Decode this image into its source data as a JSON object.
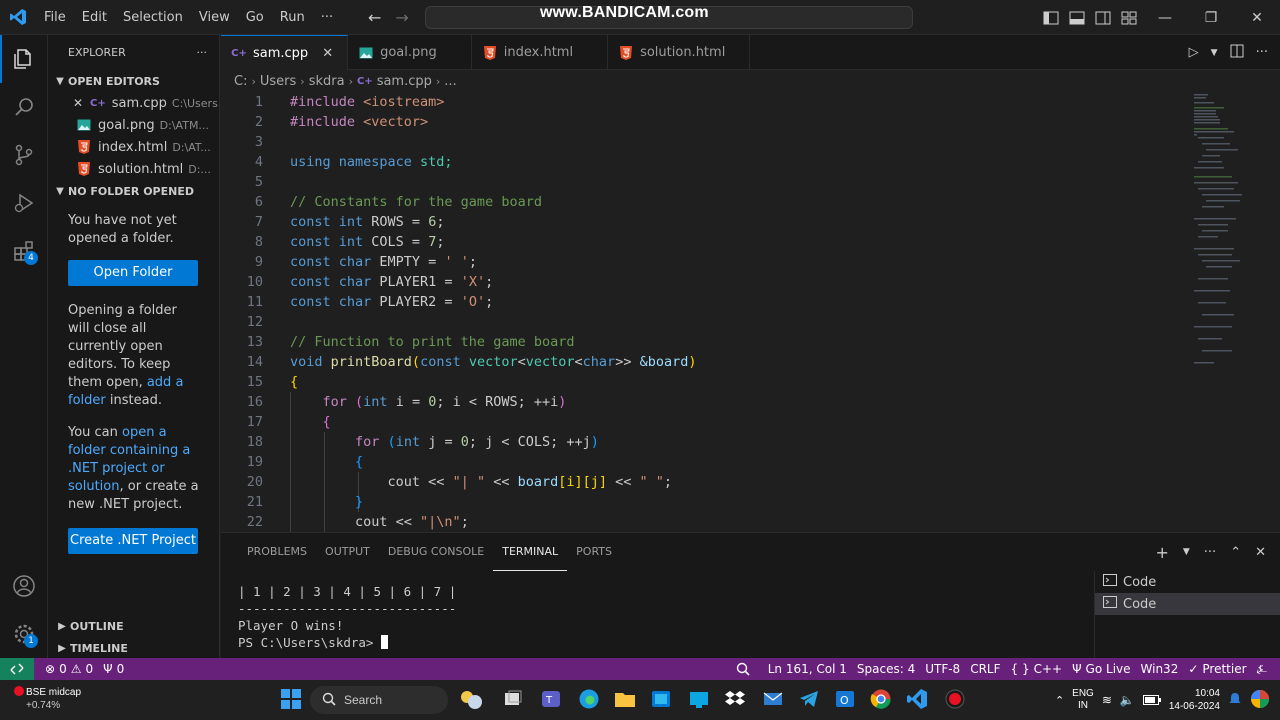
{
  "title_bar": {
    "menu": [
      "File",
      "Edit",
      "Selection",
      "View",
      "Go",
      "Run",
      "···"
    ],
    "watermark": "www.BANDICAM.com"
  },
  "sidebar": {
    "header": "EXPLORER",
    "open_editors_title": "OPEN EDITORS",
    "open_editors": [
      {
        "name": "sam.cpp",
        "path": "C:\\Users...",
        "icon": "cpp-file-icon"
      },
      {
        "name": "goal.png",
        "path": "D:\\ATM...",
        "icon": "image-file-icon"
      },
      {
        "name": "index.html",
        "path": "D:\\AT...",
        "icon": "html-file-icon"
      },
      {
        "name": "solution.html",
        "path": "D:...",
        "icon": "html-file-icon"
      }
    ],
    "no_folder_title": "NO FOLDER OPENED",
    "no_folder_text": "You have not yet opened a folder.",
    "open_folder_button": "Open Folder",
    "opening_text_1": "Opening a folder will close all currently open editors. To keep them open, ",
    "opening_link": "add a folder",
    "opening_text_2": " instead.",
    "net_text_1": "You can ",
    "net_link": "open a folder containing a .NET project or solution",
    "net_text_2": ", or create a new .NET project.",
    "create_net_button": "Create .NET Project",
    "outline_title": "OUTLINE",
    "timeline_title": "TIMELINE"
  },
  "tabs": [
    {
      "label": "sam.cpp",
      "icon": "cpp-file-icon",
      "active": true
    },
    {
      "label": "goal.png",
      "icon": "image-file-icon",
      "active": false
    },
    {
      "label": "index.html",
      "icon": "html-file-icon",
      "active": false
    },
    {
      "label": "solution.html",
      "icon": "html-file-icon",
      "active": false
    }
  ],
  "breadcrumb": [
    "C:",
    "Users",
    "skdra",
    "sam.cpp",
    "..."
  ],
  "code_lines": [
    "1",
    "2",
    "3",
    "4",
    "5",
    "6",
    "7",
    "8",
    "9",
    "10",
    "11",
    "12",
    "13",
    "14",
    "15",
    "16",
    "17",
    "18",
    "19",
    "20",
    "21",
    "22"
  ],
  "code": {
    "l1a": "#include",
    "l1b": " <iostream>",
    "l2a": "#include",
    "l2b": " <vector>",
    "l4a": "using",
    "l4b": " namespace",
    "l4c": " std;",
    "l6": "// Constants for the game board",
    "l7a": "const",
    "l7b": " int",
    "l7c": " ROWS = ",
    "l7d": "6",
    "l7e": ";",
    "l8a": "const",
    "l8b": " int",
    "l8c": " COLS = ",
    "l8d": "7",
    "l8e": ";",
    "l9a": "const",
    "l9b": " char",
    "l9c": " EMPTY = ",
    "l9d": "' '",
    "l9e": ";",
    "l10a": "const",
    "l10b": " char",
    "l10c": " PLAYER1 = ",
    "l10d": "'X'",
    "l10e": ";",
    "l11a": "const",
    "l11b": " char",
    "l11c": " PLAYER2 = ",
    "l11d": "'O'",
    "l11e": ";",
    "l13": "// Function to print the game board",
    "l14a": "void",
    "l14b": " printBoard",
    "l14c": "(",
    "l14d": "const",
    "l14e": " vector",
    "l14f": "<",
    "l14g": "vector",
    "l14h": "<",
    "l14i": "char",
    "l14j": ">>",
    "l14k": " &board",
    "l14l": ")",
    "l15": "{",
    "l16a": "    ",
    "l16b": "for",
    "l16c": " (",
    "l16d": "int",
    "l16e": " i = ",
    "l16f": "0",
    "l16g": "; i < ROWS; ++i",
    "l16h": ")",
    "l17": "    {",
    "l18a": "        ",
    "l18b": "for",
    "l18c": " (",
    "l18d": "int",
    "l18e": " j = ",
    "l18f": "0",
    "l18g": "; j < COLS; ++j",
    "l18h": ")",
    "l19": "        {",
    "l20a": "            cout << ",
    "l20b": "\"| \"",
    "l20c": " << ",
    "l20d": "board",
    "l20e": "[i][j]",
    "l20f": " << ",
    "l20g": "\" \"",
    "l20h": ";",
    "l21": "        }",
    "l22a": "        cout << ",
    "l22b": "\"|\\n\"",
    "l22c": ";"
  },
  "panel": {
    "tabs": [
      "PROBLEMS",
      "OUTPUT",
      "DEBUG CONSOLE",
      "TERMINAL",
      "PORTS"
    ],
    "active_tab": "TERMINAL",
    "terminal_lines": [
      "| 1 | 2 | 3 | 4 | 5 | 6 | 7 |",
      "-----------------------------",
      "Player O wins!",
      "PS C:\\Users\\skdra> "
    ],
    "terminals": [
      "Code",
      "Code"
    ]
  },
  "status_bar": {
    "errors": "0",
    "warnings": "0",
    "ports": "0",
    "position": "Ln 161, Col 1",
    "spaces": "Spaces: 4",
    "encoding": "UTF-8",
    "eol": "CRLF",
    "language": "C++",
    "go_live": "Go Live",
    "platform": "Win32",
    "prettier": "Prettier"
  },
  "taskbar": {
    "stock_name": "BSE midcap",
    "stock_change": "+0.74%",
    "search_placeholder": "Search",
    "lang_1": "ENG",
    "lang_2": "IN",
    "time": "10:04",
    "date": "14-06-2024"
  },
  "colors": {
    "accent": "#0078d4",
    "status_bar": "#68217a",
    "remote": "#16825d"
  }
}
